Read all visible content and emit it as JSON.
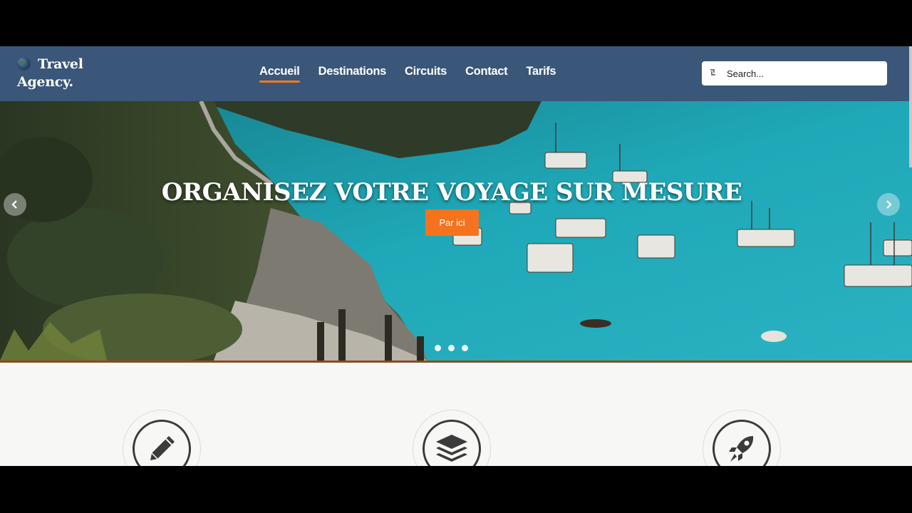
{
  "brand": {
    "line1": "Travel",
    "line2": "Agency.",
    "logo_icon": "globe-icon"
  },
  "nav": {
    "items": [
      {
        "label": "Accueil",
        "active": true
      },
      {
        "label": "Destinations",
        "active": false
      },
      {
        "label": "Circuits",
        "active": false
      },
      {
        "label": "Contact",
        "active": false
      },
      {
        "label": "Tarifs",
        "active": false
      }
    ]
  },
  "search": {
    "placeholder": "Search...",
    "icon": "search-icon"
  },
  "hero": {
    "title": "ORGANISEZ VOTRE VOYAGE SUR MESURE",
    "cta_label": "Par ici",
    "slide_count": 3,
    "prev_icon": "chevron-left-icon",
    "next_icon": "chevron-right-icon"
  },
  "features": [
    {
      "icon": "pencil-icon"
    },
    {
      "icon": "layers-icon"
    },
    {
      "icon": "rocket-icon"
    }
  ],
  "colors": {
    "header_bg": "#3a5679",
    "accent": "#f5731e",
    "border": "#8a4b1e"
  }
}
